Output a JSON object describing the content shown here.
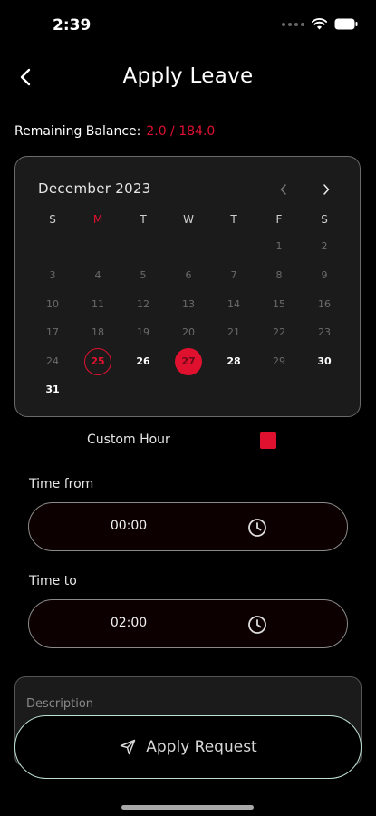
{
  "status": {
    "time": "2:39"
  },
  "header": {
    "title": "Apply Leave"
  },
  "balance": {
    "label": "Remaining Balance:",
    "value": "2.0 / 184.0"
  },
  "calendar": {
    "month": "December 2023",
    "weekdays": [
      "S",
      "M",
      "T",
      "W",
      "T",
      "F",
      "S"
    ],
    "highlight_weekday": 1,
    "first_weekday": 5,
    "days_in_month": 31,
    "today": 25,
    "selected": 27,
    "enabled_days": [
      25,
      26,
      27,
      28,
      30,
      31
    ]
  },
  "custom_hour": {
    "label": "Custom Hour",
    "checked": true
  },
  "time_from": {
    "label": "Time from",
    "value": "00:00"
  },
  "time_to": {
    "label": "Time to",
    "value": "02:00"
  },
  "description": {
    "placeholder": "Description"
  },
  "apply": {
    "label": "Apply Request"
  },
  "colors": {
    "accent": "#e0112f",
    "button_border": "#bde0d2",
    "background": "#000000"
  }
}
